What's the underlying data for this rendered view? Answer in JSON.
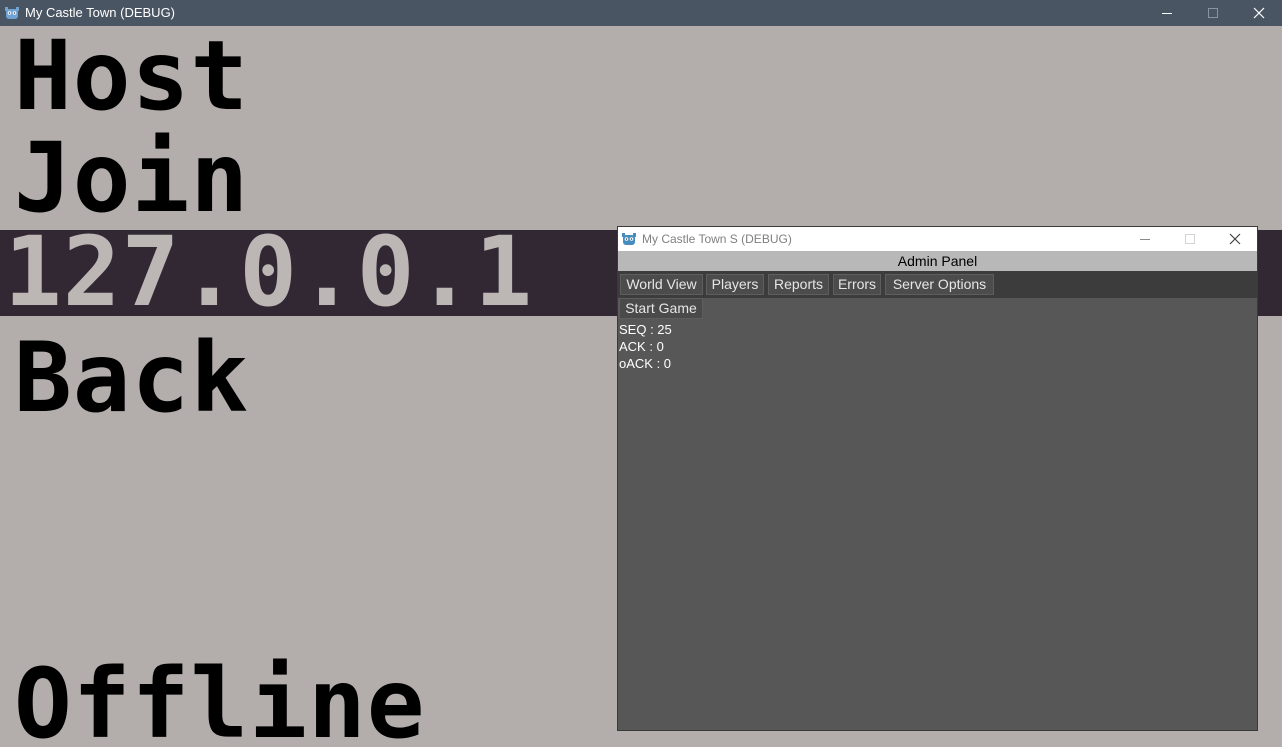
{
  "main_window": {
    "title": "My Castle Town (DEBUG)",
    "titlebar_color": "#4a5563",
    "icon": "godot-icon"
  },
  "main_menu": {
    "host_label": "Host",
    "join_label": "Join",
    "ip_address": "127.0.0.1",
    "back_label": "Back",
    "offline_label": "Offline",
    "background_color": "#b3aeac",
    "field_color": "#312834"
  },
  "server_window": {
    "title": "My Castle Town S (DEBUG)",
    "icon": "godot-icon",
    "panel_title": "Admin Panel",
    "tabs": [
      {
        "label": "World View"
      },
      {
        "label": "Players"
      },
      {
        "label": "Reports"
      },
      {
        "label": "Errors"
      },
      {
        "label": "Server Options"
      }
    ],
    "start_button_label": "Start Game",
    "stats": {
      "seq": "SEQ : 25",
      "ack": "ACK : 0",
      "oack": "oACK : 0"
    }
  }
}
